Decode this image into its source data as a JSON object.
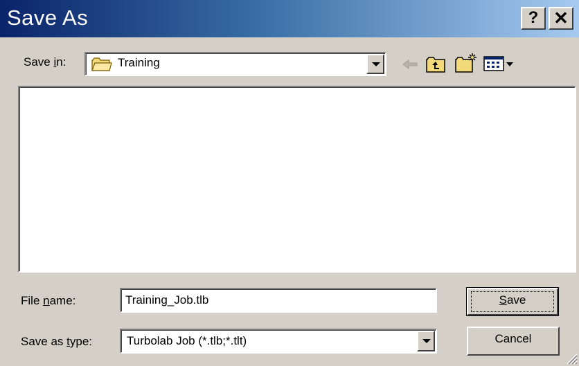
{
  "window": {
    "title": "Save As",
    "help_label": "?",
    "close_label": "✕"
  },
  "toolbar": {
    "save_in_label_pre": "Save ",
    "save_in_label_accel": "i",
    "save_in_label_post": "n:",
    "save_in_value": "Training",
    "save_in_icon": "folder-icon",
    "back_icon": "back-arrow-icon",
    "up_icon": "up-one-level-icon",
    "new_folder_icon": "new-folder-icon",
    "views_icon": "views-menu-icon"
  },
  "file_list": {
    "items": []
  },
  "filename": {
    "label_pre": "File ",
    "label_accel": "n",
    "label_post": "ame:",
    "value": "Training_Job.tlb"
  },
  "filetype": {
    "label_pre": "Save as ",
    "label_accel": "t",
    "label_post": "ype:",
    "selected": "Turbolab Job (*.tlb;*.tlt)"
  },
  "buttons": {
    "save_accel": "S",
    "save_rest": "ave",
    "cancel_label": "Cancel"
  },
  "colors": {
    "title_gradient_start": "#0a246a",
    "title_gradient_end": "#a6caf0",
    "face": "#d4d0c8"
  }
}
